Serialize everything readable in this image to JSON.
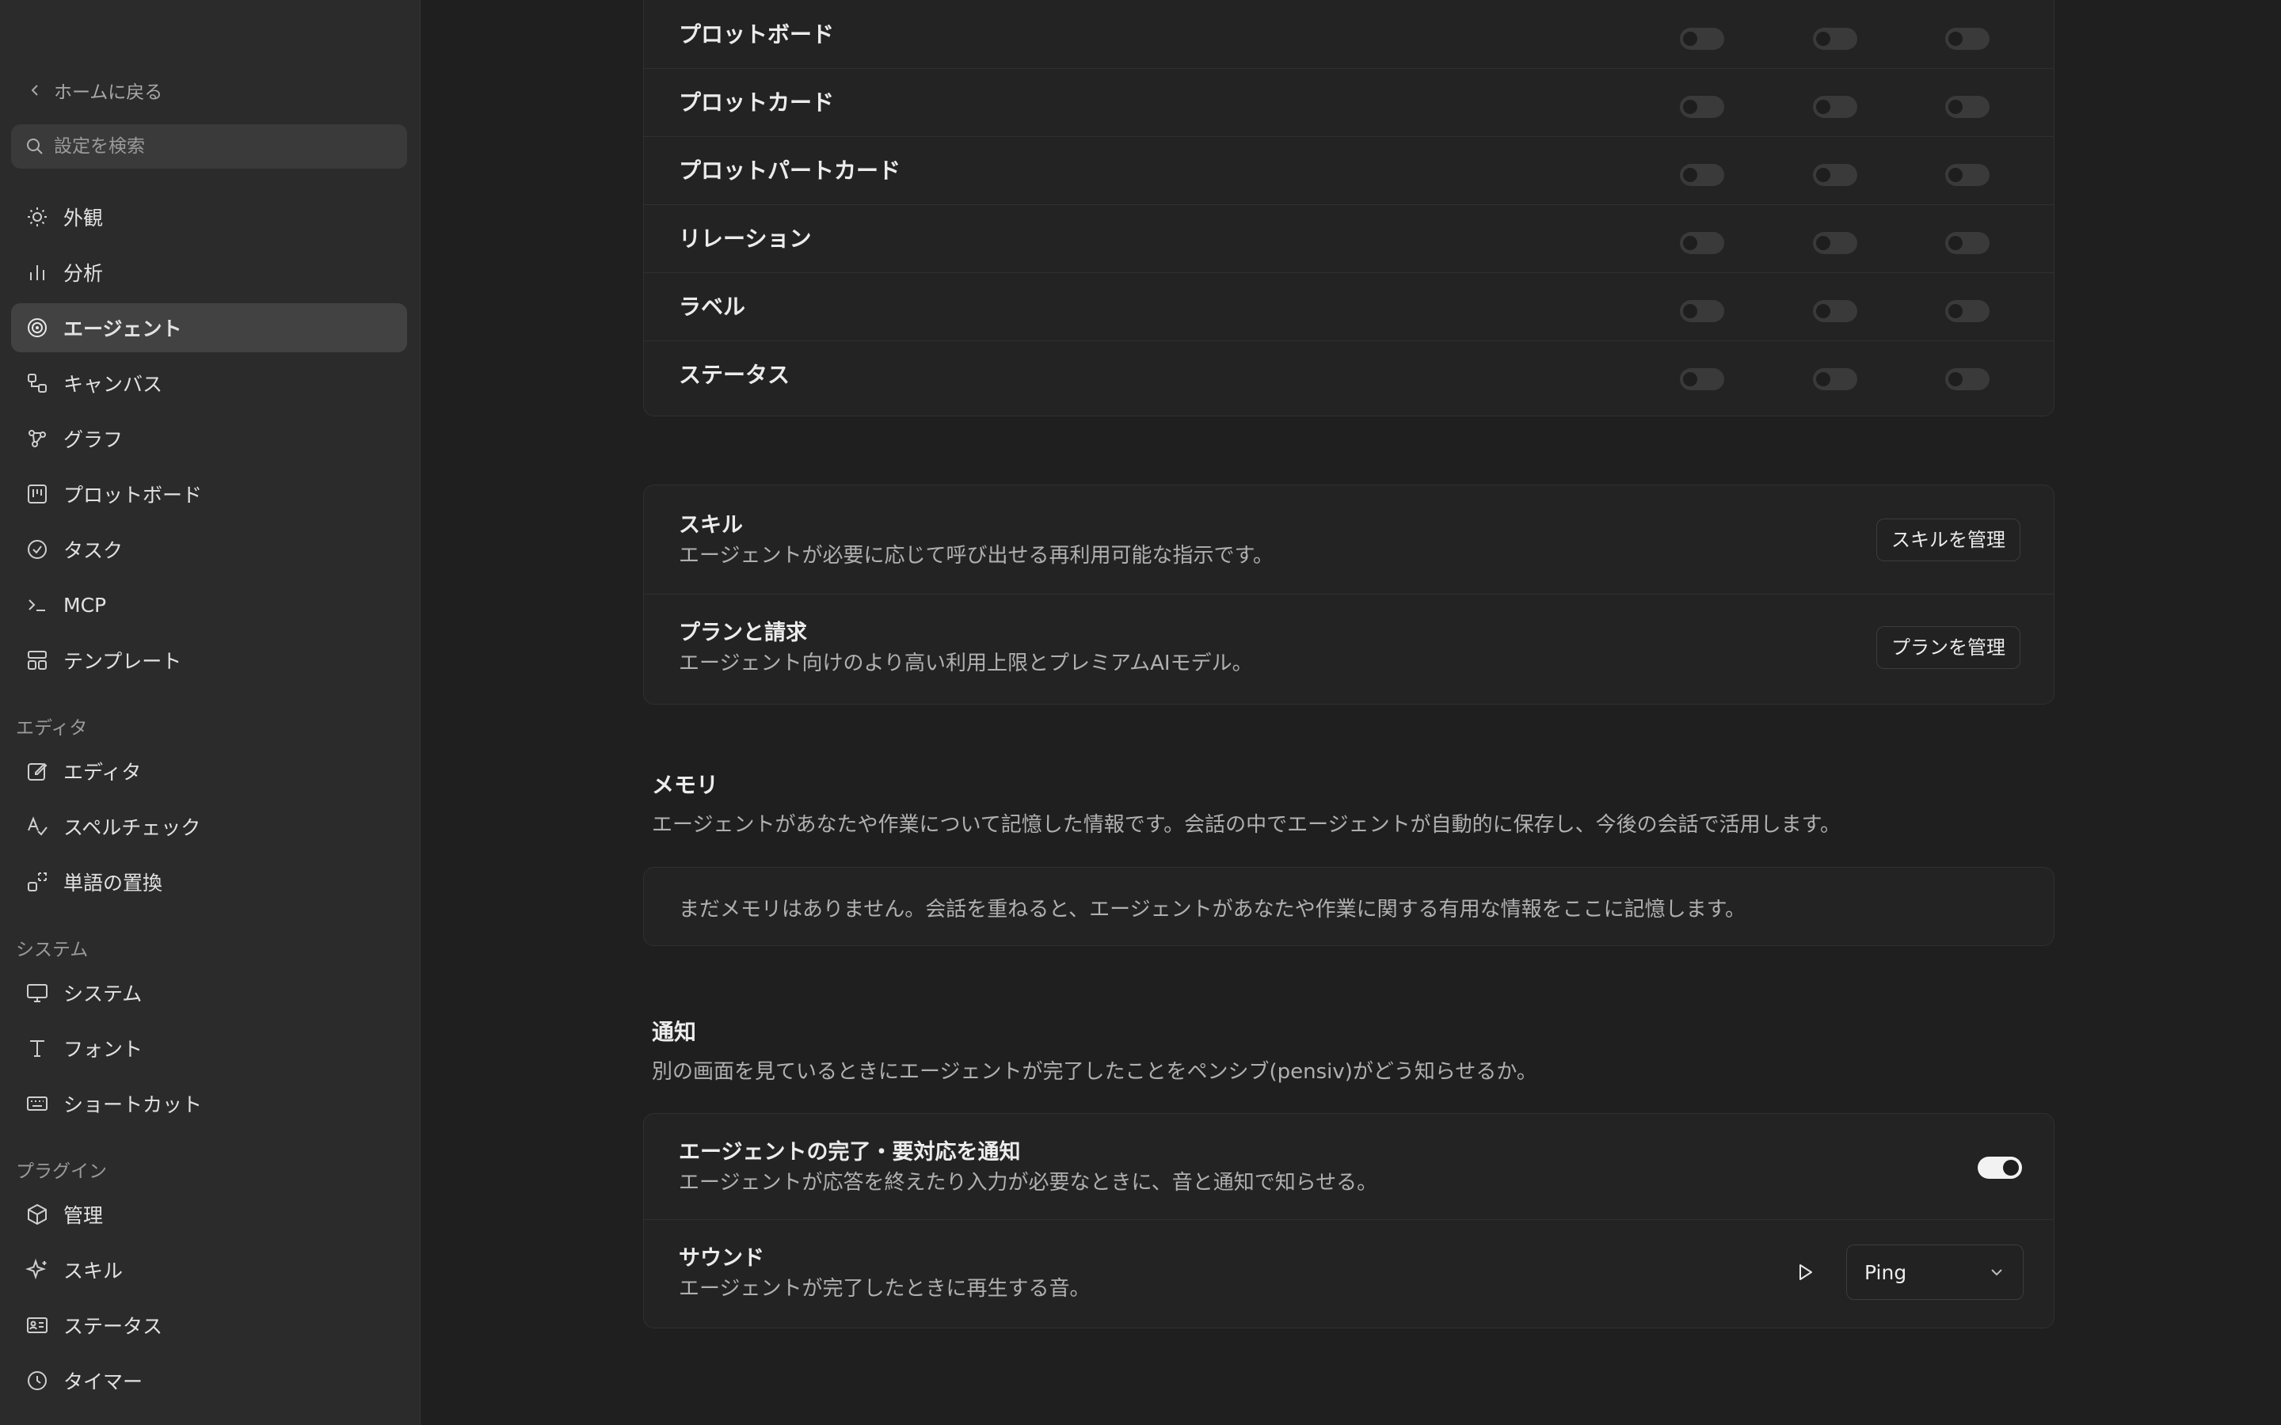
{
  "sidebar": {
    "back_label": "ホームに戻る",
    "search_placeholder": "設定を検索",
    "items": [
      {
        "label": "外観",
        "icon": "sun-icon"
      },
      {
        "label": "分析",
        "icon": "bar-chart-icon"
      },
      {
        "label": "エージェント",
        "icon": "spiral-icon",
        "active": true
      },
      {
        "label": "キャンバス",
        "icon": "canvas-icon"
      },
      {
        "label": "グラフ",
        "icon": "graph-icon"
      },
      {
        "label": "プロットボード",
        "icon": "board-icon"
      },
      {
        "label": "タスク",
        "icon": "check-circle-icon"
      },
      {
        "label": "MCP",
        "icon": "terminal-icon"
      },
      {
        "label": "テンプレート",
        "icon": "template-icon"
      }
    ],
    "group_editor": "エディタ",
    "editor_items": [
      {
        "label": "エディタ",
        "icon": "edit-icon"
      },
      {
        "label": "スペルチェック",
        "icon": "spellcheck-icon"
      },
      {
        "label": "単語の置換",
        "icon": "replace-icon"
      }
    ],
    "group_system": "システム",
    "system_items": [
      {
        "label": "システム",
        "icon": "monitor-icon"
      },
      {
        "label": "フォント",
        "icon": "font-icon"
      },
      {
        "label": "ショートカット",
        "icon": "keyboard-icon"
      }
    ],
    "group_plugins": "プラグイン",
    "plugin_items": [
      {
        "label": "管理",
        "icon": "package-icon"
      },
      {
        "label": "スキル",
        "icon": "sparkle-icon"
      },
      {
        "label": "ステータス",
        "icon": "id-card-icon"
      },
      {
        "label": "タイマー",
        "icon": "clock-icon"
      }
    ]
  },
  "permissions": {
    "rows": [
      {
        "label": "プロットボード"
      },
      {
        "label": "プロットカード"
      },
      {
        "label": "プロットパートカード"
      },
      {
        "label": "リレーション"
      },
      {
        "label": "ラベル"
      },
      {
        "label": "ステータス"
      }
    ]
  },
  "skills": {
    "title": "スキル",
    "desc": "エージェントが必要に応じて呼び出せる再利用可能な指示です。",
    "button": "スキルを管理"
  },
  "plan": {
    "title": "プランと請求",
    "desc": "エージェント向けのより高い利用上限とプレミアムAIモデル。",
    "button": "プランを管理"
  },
  "memory": {
    "title": "メモリ",
    "desc": "エージェントがあなたや作業について記憶した情報です。会話の中でエージェントが自動的に保存し、今後の会話で活用します。",
    "empty": "まだメモリはありません。会話を重ねると、エージェントがあなたや作業に関する有用な情報をここに記憶します。"
  },
  "notifications": {
    "title": "通知",
    "desc": "別の画面を見ているときにエージェントが完了したことをペンシブ(pensiv)がどう知らせるか。",
    "notify_title": "エージェントの完了・要対応を通知",
    "notify_desc": "エージェントが応答を終えたり入力が必要なときに、音と通知で知らせる。",
    "notify_on": true,
    "sound_title": "サウンド",
    "sound_desc": "エージェントが完了したときに再生する音。",
    "sound_value": "Ping"
  }
}
